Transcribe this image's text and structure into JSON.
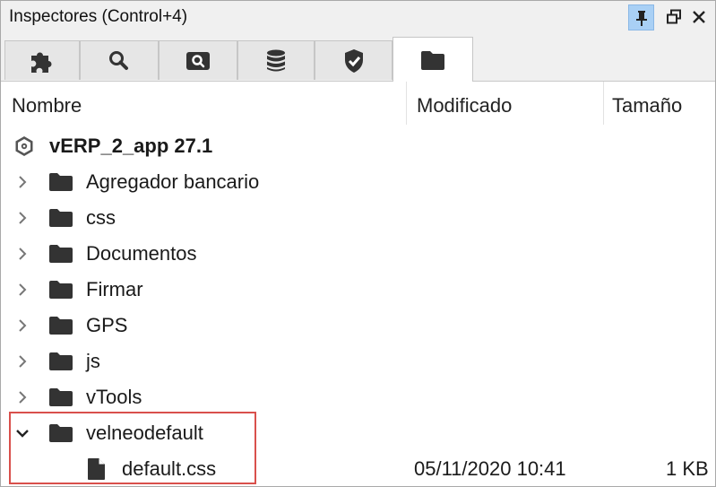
{
  "window": {
    "title": "Inspectores (Control+4)",
    "buttons": [
      "pin-icon",
      "float-icon",
      "close-icon"
    ]
  },
  "tabs": [
    {
      "icon": "puzzle-icon",
      "active": false
    },
    {
      "icon": "search-icon",
      "active": false
    },
    {
      "icon": "inspect-icon",
      "active": false
    },
    {
      "icon": "database-icon",
      "active": false
    },
    {
      "icon": "shield-icon",
      "active": false
    },
    {
      "icon": "folder-icon",
      "active": true
    }
  ],
  "columns": {
    "name": "Nombre",
    "modified": "Modificado",
    "size": "Tamaño"
  },
  "tree": {
    "root": {
      "label": "vERP_2_app 27.1",
      "icon": "project-icon"
    },
    "folders": [
      {
        "label": "Agregador bancario",
        "expanded": false
      },
      {
        "label": "css",
        "expanded": false
      },
      {
        "label": "Documentos",
        "expanded": false
      },
      {
        "label": "Firmar",
        "expanded": false
      },
      {
        "label": "GPS",
        "expanded": false
      },
      {
        "label": "js",
        "expanded": false
      },
      {
        "label": "vTools",
        "expanded": false
      },
      {
        "label": "velneodefault",
        "expanded": true
      }
    ],
    "file": {
      "label": "default.css",
      "modified": "05/11/2020 10:41",
      "size": "1 KB",
      "icon": "file-icon"
    }
  },
  "colors": {
    "highlight": "#d9504c",
    "pin_active": "#a9d0f5",
    "icon": "#333333"
  }
}
